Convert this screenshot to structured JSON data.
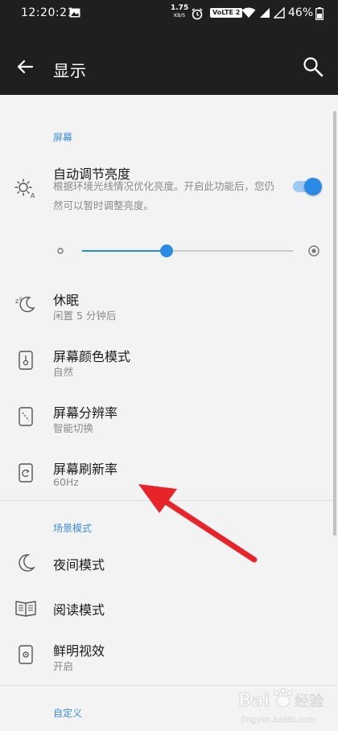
{
  "status_bar": {
    "time": "12:20:21",
    "net_speed_value": "1.75",
    "net_speed_unit": "KB/S",
    "volte": "VoLTE 2",
    "battery": "46%"
  },
  "app_bar": {
    "title": "显示"
  },
  "sections": {
    "screen": "屏幕",
    "scene": "场景模式",
    "custom": "自定义"
  },
  "settings": {
    "auto_brightness": {
      "title": "自动调节亮度",
      "summary": "根据环境光线情况优化亮度。开启此功能后，您仍然可以暂时调整亮度。",
      "enabled": true
    },
    "brightness_level": 0.4,
    "sleep": {
      "title": "休眠",
      "summary": "闲置 5 分钟后"
    },
    "color_mode": {
      "title": "屏幕颜色模式",
      "summary": "自然"
    },
    "resolution": {
      "title": "屏幕分辨率",
      "summary": "智能切换"
    },
    "refresh_rate": {
      "title": "屏幕刷新率",
      "summary": "60Hz"
    },
    "night_mode": {
      "title": "夜间模式"
    },
    "reading_mode": {
      "title": "阅读模式"
    },
    "vivid": {
      "title": "鲜明视效",
      "summary": "开启"
    }
  },
  "colors": {
    "accent": "#2b8ae6",
    "section_header": "#3a8ee0",
    "annotation_arrow": "#e8232a"
  },
  "watermark": {
    "brand": "Bai",
    "text": "经验",
    "domain": "jingyan.baidu.com"
  }
}
